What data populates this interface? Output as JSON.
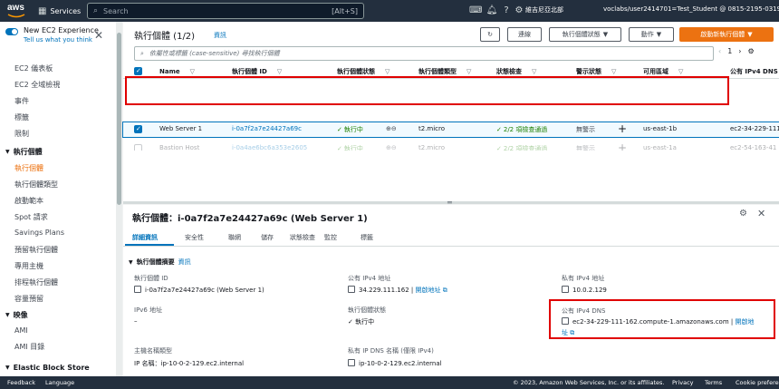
{
  "topnav": {
    "logo": "aws",
    "services_label": "Services",
    "search_placeholder": "Search",
    "search_shortcut": "[Alt+S]",
    "region": "維吉尼亞北部",
    "account": "voclabs/user2414701=Test_Student @ 0815-2195-0319",
    "icons": [
      "terminal-icon",
      "bell-icon",
      "help-icon",
      "settings-icon"
    ]
  },
  "sidebar": {
    "new_experience": "New EC2 Experience",
    "tell_us": "Tell us what you think",
    "top_items": [
      "EC2 儀表板",
      "EC2 全域檢視",
      "事件",
      "標籤",
      "限制"
    ],
    "section_instances": "執行個體",
    "instance_items": [
      "執行個體",
      "執行個體類型",
      "啟動範本",
      "Spot 請求",
      "Savings Plans",
      "預留執行個體",
      "專用主機",
      "排程執行個體",
      "容量預留"
    ],
    "active_item": "執行個體",
    "section_images": "映像",
    "image_items": [
      "AMI",
      "AMI 目錄"
    ],
    "section_ebs": "Elastic Block Store"
  },
  "instances_panel": {
    "title": "執行個體 (1/2)",
    "info": "資訊",
    "buttons": {
      "refresh": "↻",
      "connect": "連線",
      "state": "執行個體狀態",
      "actions": "動作",
      "launch": "啟動新執行個體"
    },
    "filter_placeholder": "依屬性或標籤 (case-sensitive) 尋找執行個體",
    "page": "1",
    "columns": [
      "Name",
      "執行個體 ID",
      "執行個體狀態",
      "執行個體類型",
      "狀態檢查",
      "警示狀態",
      "可用區域",
      "公有 IPv4 DNS"
    ],
    "rows": [
      {
        "name": "Web Server 1",
        "id": "i-0a7f2a7e24427a69c",
        "state": "執行中",
        "type": "t2.micro",
        "check": "2/2 項檢查通過",
        "alarm": "無警示",
        "az": "us-east-1b",
        "dns": "ec2-34-229-111-162",
        "selected": true
      },
      {
        "name": "Bastion Host",
        "id": "i-0a4ae6bc6a353e2605",
        "state": "執行中",
        "type": "t2.micro",
        "check": "2/2 項檢查通過",
        "alarm": "無警示",
        "az": "us-east-1a",
        "dns": "ec2-54-163-41",
        "selected": false
      }
    ]
  },
  "details": {
    "title": "執行個體：i-0a7f2a7e24427a69c (Web Server 1)",
    "tabs": [
      "詳細資訊",
      "安全性",
      "聯網",
      "儲存",
      "狀態檢查",
      "監控",
      "標籤"
    ],
    "summary_title": "執行個體摘要",
    "summary_info": "資訊",
    "fields": {
      "instance_id_label": "執行個體 ID",
      "instance_id_value": "i-0a7f2a7e24427a69c (Web Server 1)",
      "public_ipv4_label": "公有 IPv4 地址",
      "public_ipv4_value": "34.229.111.162",
      "open_address": "開啟地址",
      "private_ipv4_label": "私有 IPv4 地址",
      "private_ipv4_value": "10.0.2.129",
      "ipv6_label": "IPv6 地址",
      "ipv6_value": "–",
      "state_label": "執行個體狀態",
      "state_value": "執行中",
      "public_dns_label": "公有 IPv4 DNS",
      "public_dns_value": "ec2-34-229-111-162.compute-1.amazonaws.com",
      "open_address_2a": "開啟地",
      "open_address_2b": "址",
      "hostname_label": "主機名稱類型",
      "hostname_value": "IP 名稱：ip-10-0-2-129.ec2.internal",
      "private_dns_label": "私有 IP DNS 名稱 (僅限 IPv4)",
      "private_dns_value": "ip-10-0-2-129.ec2.internal"
    }
  },
  "footer": {
    "feedback": "Feedback",
    "language": "Language",
    "copyright": "© 2023, Amazon Web Services, Inc. or its affiliates.",
    "privacy": "Privacy",
    "terms": "Terms",
    "cookies": "Cookie preferences"
  },
  "colors": {
    "nav": "#232f3e",
    "accent": "#ec7211",
    "link": "#0073bb",
    "success": "#1d8102",
    "highlight": "#e00000"
  }
}
